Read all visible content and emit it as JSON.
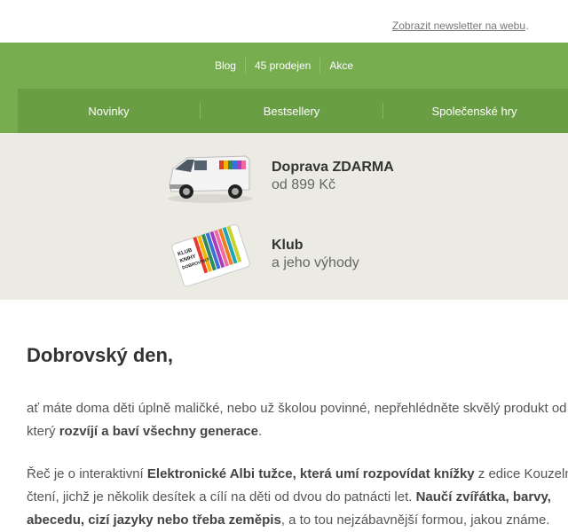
{
  "topbar": {
    "link": "Zobrazit newsletter na webu",
    "dot": "."
  },
  "nav_top": [
    "Blog",
    "45 prodejen",
    "Akce"
  ],
  "nav_main": [
    "Novinky",
    "Bestsellery",
    "Společenské hry"
  ],
  "promos": [
    {
      "title": "Doprava ZDARMA",
      "sub": "od 899 Kč"
    },
    {
      "title": "Klub",
      "sub": "a jeho výhody"
    }
  ],
  "card_text": [
    "KLUB",
    "KNIHY",
    "DOBROVSKÝ"
  ],
  "heading": "Dobrovský den,",
  "para1": {
    "a": "ať máte doma děti úplně maličké, nebo už školou povinné, nepřehlédněte skvělý produkt od",
    "b": "který ",
    "c": "rozvíjí a baví všechny generace",
    "d": "."
  },
  "para2": {
    "a": "Řeč je o interaktivní ",
    "b": "Elektronické Albi tužce, která umí rozpovídat knížky",
    "c": " z edice Kouzelné",
    "d": "čtení, jichž je několik desítek a cílí na děti od dvou do patnácti let. ",
    "e": "Naučí zvířátka, barvy,",
    "f": "abecedu, cizí jazyky nebo třeba zeměpis",
    "g": ", a to tou nejzábavnější formou, jakou známe."
  },
  "colors": {
    "green": "#77ad4f",
    "green_dark": "#6a9e45",
    "promo_bg": "#ebebe3"
  }
}
